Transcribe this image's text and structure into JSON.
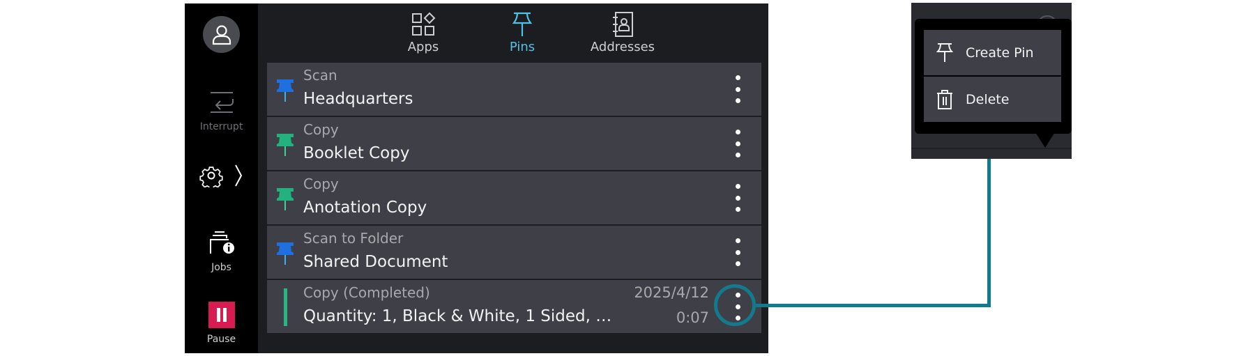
{
  "sidebar": {
    "avatar_icon": "user-icon",
    "interrupt": {
      "label": "Interrupt",
      "icon": "interrupt-icon"
    },
    "settings": {
      "icon": "gear-icon",
      "chevron": "chevron-right-icon"
    },
    "jobs": {
      "label": "Jobs",
      "icon": "jobs-info-icon"
    },
    "pause": {
      "label": "Pause",
      "icon": "pause-icon",
      "color": "#d81b50"
    }
  },
  "tabs": [
    {
      "label": "Apps",
      "icon": "apps-grid-icon",
      "active": false
    },
    {
      "label": "Pins",
      "icon": "pin-icon",
      "active": true,
      "color": "#4fc3e6"
    },
    {
      "label": "Addresses",
      "icon": "address-book-icon",
      "active": false
    }
  ],
  "list": {
    "items": [
      {
        "type": "Scan",
        "name": "Headquarters",
        "pin_color": "#1e6fe0"
      },
      {
        "type": "Copy",
        "name": "Booklet Copy",
        "pin_color": "#22b27e"
      },
      {
        "type": "Copy",
        "name": "Anotation Copy",
        "pin_color": "#22b27e"
      },
      {
        "type": "Scan to Folder",
        "name": "Shared Document",
        "pin_color": "#1e6fe0"
      }
    ],
    "history": {
      "type": "Copy (Completed)",
      "details": "Quantity: 1, Black & White, 1 Sided, …",
      "date": "2025/4/12",
      "time": "0:07",
      "status_color": "#2bb582"
    }
  },
  "popup": {
    "items": [
      {
        "label": "Create Pin",
        "icon": "pin-icon"
      },
      {
        "label": "Delete",
        "icon": "trash-icon"
      }
    ]
  },
  "annotation": {
    "color": "#127a8c"
  }
}
